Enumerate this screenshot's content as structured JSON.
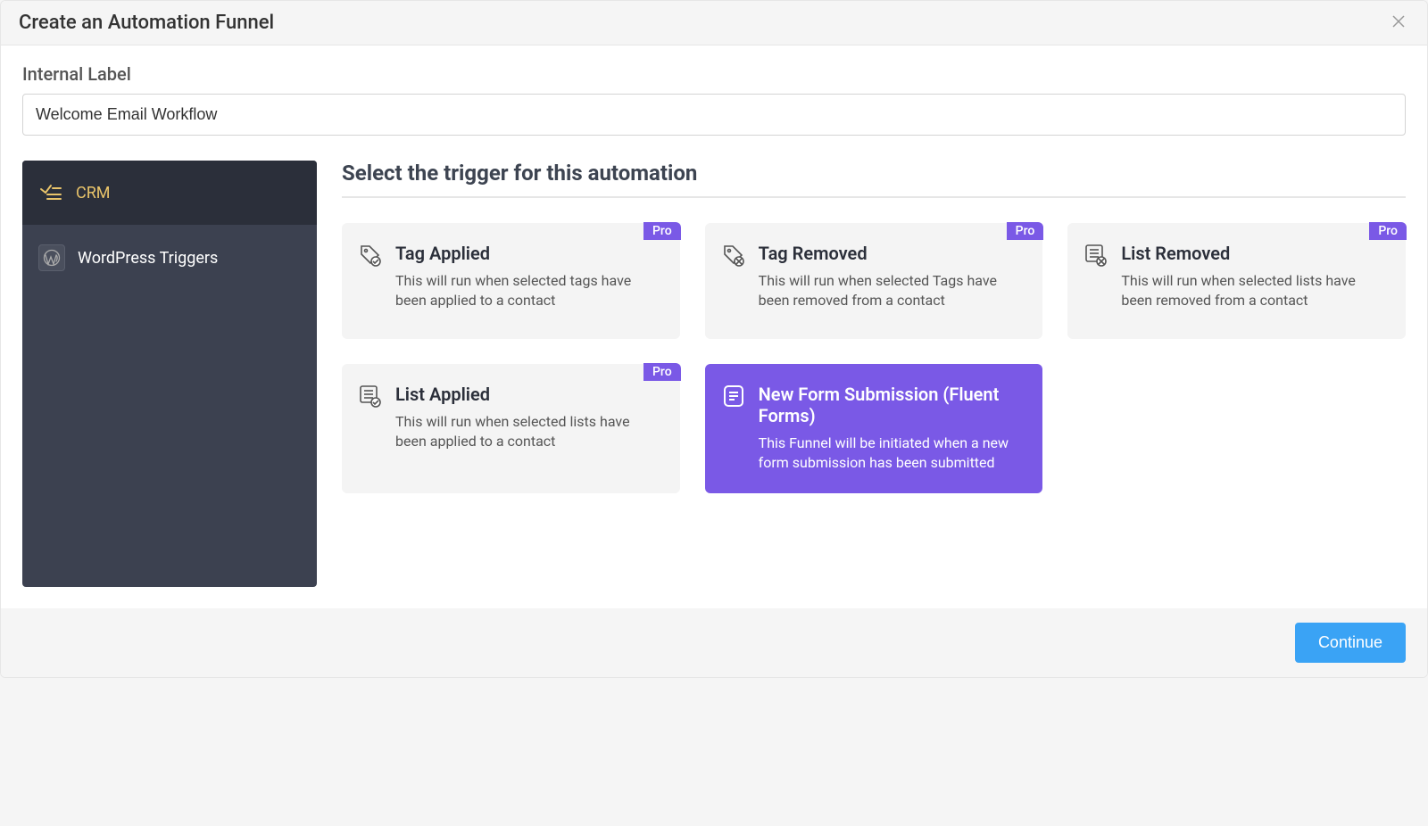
{
  "header": {
    "title": "Create an Automation Funnel"
  },
  "form": {
    "internal_label_label": "Internal Label",
    "internal_label_value": "Welcome Email Workflow"
  },
  "sidebar": {
    "items": [
      {
        "label": "CRM",
        "icon": "crm-icon",
        "active": true
      },
      {
        "label": "WordPress Triggers",
        "icon": "wordpress-icon",
        "active": false
      }
    ]
  },
  "main": {
    "section_title": "Select the trigger for this automation",
    "pro_badge": "Pro",
    "cards": [
      {
        "title": "Tag Applied",
        "description": "This will run when selected tags have been applied to a contact",
        "badge": "Pro",
        "selected": false
      },
      {
        "title": "Tag Removed",
        "description": "This will run when selected Tags have been removed from a contact",
        "badge": "Pro",
        "selected": false
      },
      {
        "title": "List Removed",
        "description": "This will run when selected lists have been removed from a contact",
        "badge": "Pro",
        "selected": false
      },
      {
        "title": "List Applied",
        "description": "This will run when selected lists have been applied to a contact",
        "badge": "Pro",
        "selected": false
      },
      {
        "title": "New Form Submission (Fluent Forms)",
        "description": "This Funnel will be initiated when a new form submission has been submitted",
        "badge": null,
        "selected": true
      }
    ]
  },
  "footer": {
    "continue_label": "Continue"
  }
}
